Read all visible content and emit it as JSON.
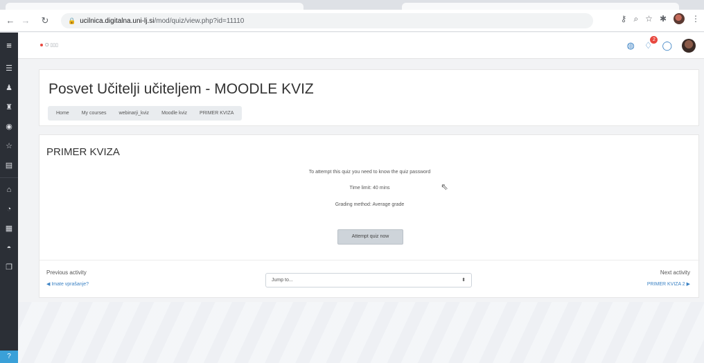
{
  "browser": {
    "url_host": "ucilnica.digitalna.uni-lj.si",
    "url_path": "/mod/quiz/view.php?id=11110",
    "icons": [
      "back-icon",
      "forward-icon",
      "reload-icon",
      "lock-icon",
      "key-icon",
      "zoom-icon",
      "star-icon",
      "extensions-icon",
      "profile-icon",
      "menu-icon"
    ]
  },
  "navbar": {
    "logo_text": "O ▯▯▯",
    "notification_count": "2",
    "accent_color": "#3b82c4",
    "badge_color": "#e8483f"
  },
  "header": {
    "title": "Posvet Učitelji učiteljem - MOODLE KVIZ",
    "breadcrumb": [
      "Home",
      "My courses",
      "webinarji_kviz",
      "Moodle kviz",
      "PRIMER KVIZA"
    ]
  },
  "quiz": {
    "title": "PRIMER KVIZA",
    "password_notice": "To attempt this quiz you need to know the quiz password",
    "time_limit": "Time limit: 40 mins",
    "grading_method": "Grading method: Average grade",
    "attempt_button": "Attempt quiz now"
  },
  "activity_nav": {
    "previous_label": "Previous activity",
    "previous_link": "◀ Imate vprašanje?",
    "jump_placeholder": "Jump to...",
    "next_label": "Next activity",
    "next_link": "PRIMER KVIZA 2 ▶"
  }
}
